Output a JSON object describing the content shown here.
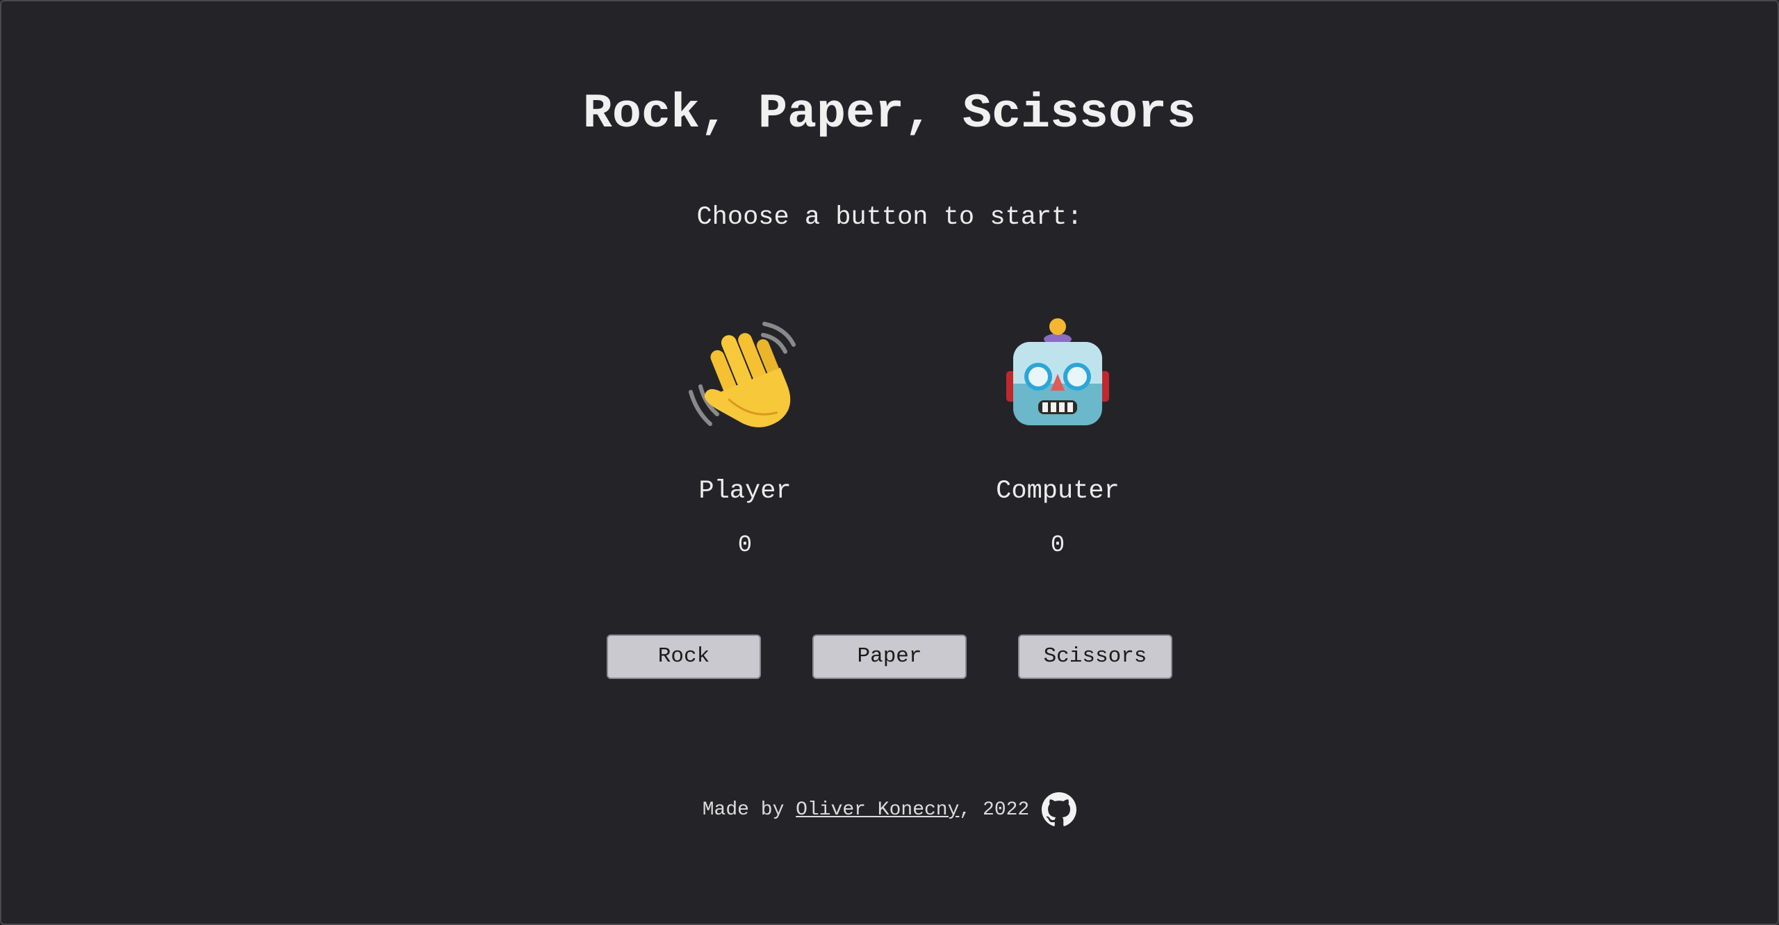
{
  "title": "Rock, Paper, Scissors",
  "subtitle": "Choose a button to start:",
  "player": {
    "icon": "waving-hand-icon",
    "label": "Player",
    "score": "0"
  },
  "computer": {
    "icon": "robot-icon",
    "label": "Computer",
    "score": "0"
  },
  "buttons": {
    "rock": "Rock",
    "paper": "Paper",
    "scissors": "Scissors"
  },
  "footer": {
    "prefix": "Made by ",
    "author": "Oliver Konecny",
    "suffix": ", 2022",
    "icon": "github-icon"
  },
  "colors": {
    "background": "#242428",
    "button": "#c9c9cf",
    "text": "#ececec"
  }
}
